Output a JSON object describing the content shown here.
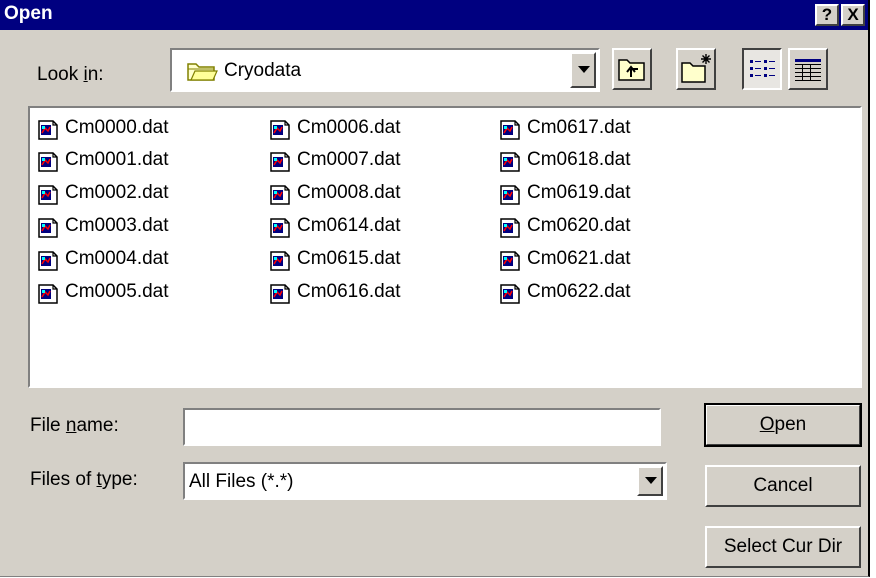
{
  "window": {
    "title": "Open",
    "help_label": "?",
    "close_label": "X"
  },
  "look_in": {
    "label": "Look in:",
    "label_prefix": "Look ",
    "label_accel": "i",
    "label_suffix": "n:",
    "value": "Cryodata"
  },
  "toolbar": {
    "buttons": [
      "up-one-level",
      "create-new-folder",
      "list-view",
      "details-view"
    ]
  },
  "files": [
    "Cm0000.dat",
    "Cm0001.dat",
    "Cm0002.dat",
    "Cm0003.dat",
    "Cm0004.dat",
    "Cm0005.dat",
    "Cm0006.dat",
    "Cm0007.dat",
    "Cm0008.dat",
    "Cm0614.dat",
    "Cm0615.dat",
    "Cm0616.dat",
    "Cm0617.dat",
    "Cm0618.dat",
    "Cm0619.dat",
    "Cm0620.dat",
    "Cm0621.dat",
    "Cm0622.dat"
  ],
  "file_name": {
    "label": "File name:",
    "label_prefix": "File ",
    "label_accel": "n",
    "label_suffix": "ame:",
    "value": ""
  },
  "file_type": {
    "label": "Files of type:",
    "label_prefix": "Files of ",
    "label_accel": "t",
    "label_suffix": "ype:",
    "value": "All Files (*.*)"
  },
  "buttons": {
    "open": "Open",
    "open_accel": "O",
    "open_rest": "pen",
    "cancel": "Cancel",
    "select_dir": "Select Cur Dir"
  },
  "colors": {
    "titlebar": "#000080",
    "face": "#d4d0c8",
    "window_bg": "#ffffff"
  }
}
